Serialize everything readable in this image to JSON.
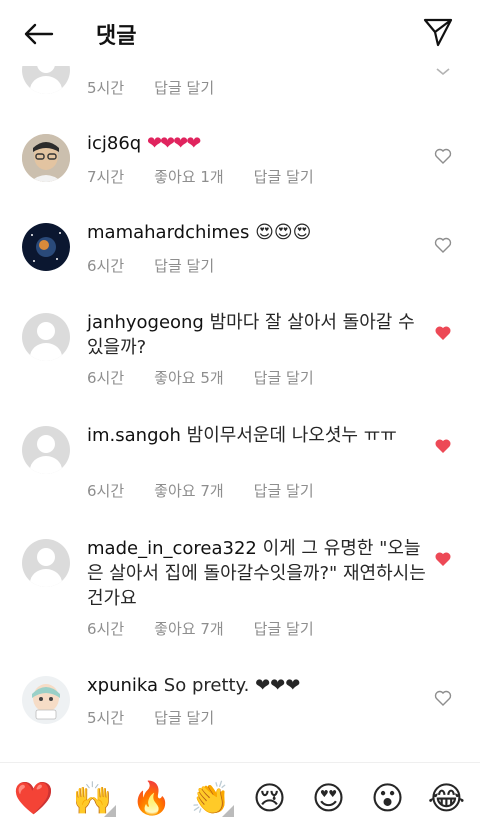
{
  "header": {
    "title": "댓글"
  },
  "comments": [
    {
      "username": "",
      "text": "",
      "time": "5시간",
      "likes": "",
      "reply": "답글 달기",
      "liked": false,
      "avatar": "default"
    },
    {
      "username": "icj86q",
      "text": "❤❤❤❤",
      "time": "7시간",
      "likes": "좋아요 1개",
      "reply": "답글 달기",
      "liked": false,
      "avatar": "photo-person"
    },
    {
      "username": "mamahardchimes",
      "text": "😍😍😍",
      "time": "6시간",
      "likes": "",
      "reply": "답글 달기",
      "liked": false,
      "avatar": "photo-galaxy"
    },
    {
      "username": "janhyogeong",
      "text": "밤마다 잘 살아서 돌아갈 수 있을까?",
      "time": "6시간",
      "likes": "좋아요 5개",
      "reply": "답글 달기",
      "liked": true,
      "avatar": "default"
    },
    {
      "username": "im.sangoh",
      "text": "밤이무서운데 나오셧누 ㅠㅠ",
      "time": "6시간",
      "likes": "좋아요 7개",
      "reply": "답글 달기",
      "liked": true,
      "avatar": "default"
    },
    {
      "username": "made_in_corea322",
      "text": "이게 그 유명한 \"오늘은 살아서 집에 돌아갈수잇을까?\" 재연하시는건가요",
      "time": "6시간",
      "likes": "좋아요 7개",
      "reply": "답글 달기",
      "liked": true,
      "avatar": "default"
    },
    {
      "username": "xpunika",
      "text": "So pretty. ❤❤❤",
      "time": "5시간",
      "likes": "",
      "reply": "답글 달기",
      "liked": false,
      "avatar": "photo-illustration"
    }
  ],
  "emoji_bar": [
    "❤️",
    "🙌",
    "🔥",
    "👏",
    "😢",
    "😍",
    "😮",
    "😂"
  ],
  "colors": {
    "liked": "#ed4956",
    "muted": "#8e8e8e"
  }
}
